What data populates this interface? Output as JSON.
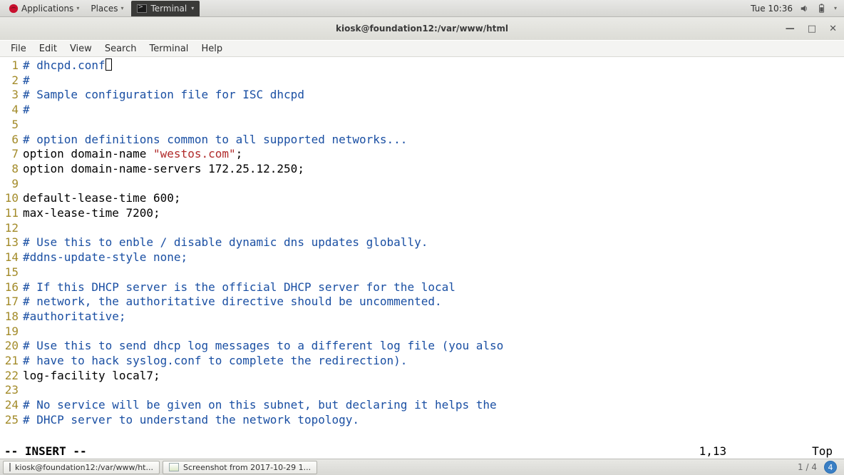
{
  "panel": {
    "applications": "Applications",
    "places": "Places",
    "active_task": "Terminal",
    "clock": "Tue 10:36"
  },
  "window": {
    "title": "kiosk@foundation12:/var/www/html"
  },
  "menubar": [
    "File",
    "Edit",
    "View",
    "Search",
    "Terminal",
    "Help"
  ],
  "editor": {
    "lines": [
      {
        "n": 1,
        "seg": [
          {
            "t": "# dhcpd.conf",
            "c": "c-comment"
          },
          {
            "t": "__CURSOR__",
            "c": "cur"
          }
        ]
      },
      {
        "n": 2,
        "seg": [
          {
            "t": "#",
            "c": "c-comment"
          }
        ]
      },
      {
        "n": 3,
        "seg": [
          {
            "t": "# Sample configuration file for ISC dhcpd",
            "c": "c-comment"
          }
        ]
      },
      {
        "n": 4,
        "seg": [
          {
            "t": "#",
            "c": "c-comment"
          }
        ]
      },
      {
        "n": 5,
        "seg": []
      },
      {
        "n": 6,
        "seg": [
          {
            "t": "# option definitions common to all supported networks...",
            "c": "c-comment"
          }
        ]
      },
      {
        "n": 7,
        "seg": [
          {
            "t": "option domain-name ",
            "c": ""
          },
          {
            "t": "\"westos.com\"",
            "c": "c-string"
          },
          {
            "t": ";",
            "c": ""
          }
        ]
      },
      {
        "n": 8,
        "seg": [
          {
            "t": "option domain-name-servers 172.25.12.250;",
            "c": ""
          }
        ]
      },
      {
        "n": 9,
        "seg": []
      },
      {
        "n": 10,
        "seg": [
          {
            "t": "default-lease-time 600;",
            "c": ""
          }
        ]
      },
      {
        "n": 11,
        "seg": [
          {
            "t": "max-lease-time 7200;",
            "c": ""
          }
        ]
      },
      {
        "n": 12,
        "seg": []
      },
      {
        "n": 13,
        "seg": [
          {
            "t": "# Use this to enble / disable dynamic dns updates globally.",
            "c": "c-comment"
          }
        ]
      },
      {
        "n": 14,
        "seg": [
          {
            "t": "#ddns-update-style none;",
            "c": "c-comment"
          }
        ]
      },
      {
        "n": 15,
        "seg": []
      },
      {
        "n": 16,
        "seg": [
          {
            "t": "# If this DHCP server is the official DHCP server for the local",
            "c": "c-comment"
          }
        ]
      },
      {
        "n": 17,
        "seg": [
          {
            "t": "# network, the authoritative directive should be uncommented.",
            "c": "c-comment"
          }
        ]
      },
      {
        "n": 18,
        "seg": [
          {
            "t": "#authoritative;",
            "c": "c-comment"
          }
        ]
      },
      {
        "n": 19,
        "seg": []
      },
      {
        "n": 20,
        "seg": [
          {
            "t": "# Use this to send dhcp log messages to a different log file (you also",
            "c": "c-comment"
          }
        ]
      },
      {
        "n": 21,
        "seg": [
          {
            "t": "# have to hack syslog.conf to complete the redirection).",
            "c": "c-comment"
          }
        ]
      },
      {
        "n": 22,
        "seg": [
          {
            "t": "log-facility local7;",
            "c": ""
          }
        ]
      },
      {
        "n": 23,
        "seg": []
      },
      {
        "n": 24,
        "seg": [
          {
            "t": "# No service will be given on this subnet, but declaring it helps the",
            "c": "c-comment"
          }
        ]
      },
      {
        "n": 25,
        "seg": [
          {
            "t": "# DHCP server to understand the network topology.",
            "c": "c-comment"
          }
        ]
      }
    ]
  },
  "status": {
    "mode": "-- INSERT --",
    "pos": "1,13",
    "scroll": "Top"
  },
  "taskbar": {
    "btn1": "kiosk@foundation12:/var/www/ht...",
    "btn2": "Screenshot from 2017-10-29 1...",
    "ws_count": "1 / 4",
    "ws_current": "4"
  }
}
